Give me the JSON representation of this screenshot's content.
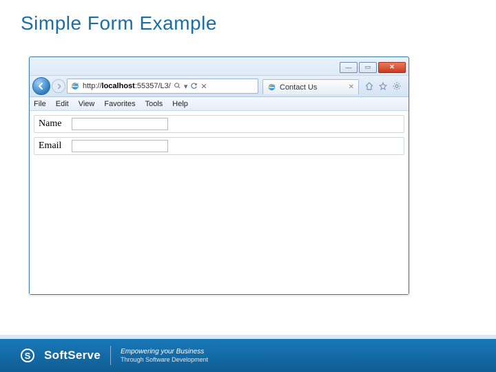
{
  "slide": {
    "title": "Simple Form Example"
  },
  "browser": {
    "window_controls": {
      "min": "—",
      "max": "▭",
      "close": "✕"
    },
    "address": {
      "scheme": "http://",
      "host": "localhost",
      "rest": ":55357/L3/"
    },
    "tab": {
      "title": "Contact Us"
    },
    "menus": [
      "File",
      "Edit",
      "View",
      "Favorites",
      "Tools",
      "Help"
    ],
    "form": {
      "fields": [
        {
          "label": "Name",
          "value": ""
        },
        {
          "label": "Email",
          "value": ""
        }
      ]
    }
  },
  "footer": {
    "brand": "SoftServe",
    "tagline_l1": "Empowering your Business",
    "tagline_l2": "Through Software Development"
  }
}
